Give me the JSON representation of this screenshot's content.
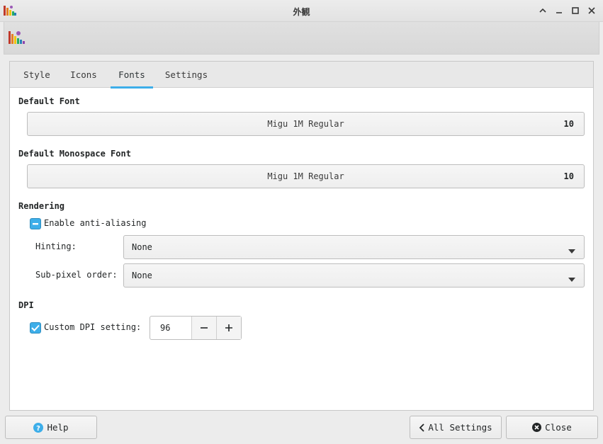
{
  "window": {
    "title": "外観"
  },
  "tabs": [
    {
      "label": "Style",
      "mnemonic": "y"
    },
    {
      "label": "Icons",
      "mnemonic": "I"
    },
    {
      "label": "Fonts",
      "mnemonic": "F",
      "active": true
    },
    {
      "label": "Settings",
      "mnemonic": "n"
    }
  ],
  "fonts": {
    "default": {
      "label": "Default Font",
      "name": "Migu 1M Regular",
      "size": "10"
    },
    "monospace": {
      "label": "Default Monospace Font",
      "name": "Migu 1M Regular",
      "size": "10"
    }
  },
  "rendering": {
    "label": "Rendering",
    "antialias_label": "Enable anti-aliasing",
    "antialias_state": "partial",
    "hinting_label": "Hinting:",
    "hinting_value": "None",
    "subpixel_label": "Sub-pixel order:",
    "subpixel_value": "None"
  },
  "dpi": {
    "label": "DPI",
    "custom_label": "Custom DPI setting:",
    "custom_checked": true,
    "value": "96"
  },
  "footer": {
    "help": "Help",
    "all_settings": "All Settings",
    "close": "Close"
  },
  "colors": {
    "accent": "#3daee9",
    "window_bg": "#ececec",
    "panel_bg": "#ffffff"
  }
}
